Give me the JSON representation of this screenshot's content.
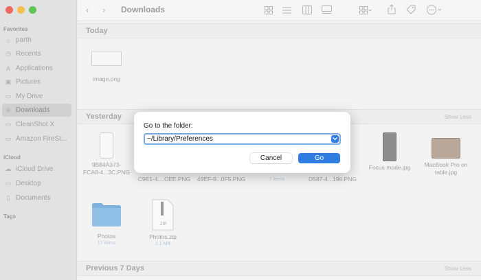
{
  "window": {
    "title": "Downloads"
  },
  "colors": {
    "close": "#ed6a5e",
    "minimize": "#f5bf4f",
    "zoom": "#61c554",
    "accent": "#2f7de1"
  },
  "sidebar": {
    "favorites_label": "Favorites",
    "favorites": [
      {
        "label": "parth",
        "icon": "home-icon"
      },
      {
        "label": "Recents",
        "icon": "clock-icon"
      },
      {
        "label": "Applications",
        "icon": "applications-icon"
      },
      {
        "label": "Pictures",
        "icon": "pictures-icon"
      },
      {
        "label": "My Drive",
        "icon": "drive-icon"
      },
      {
        "label": "Downloads",
        "icon": "download-icon",
        "selected": true
      },
      {
        "label": "CleanShot X",
        "icon": "folder-icon"
      },
      {
        "label": "Amazon FireSt...",
        "icon": "folder-icon"
      }
    ],
    "icloud_label": "iCloud",
    "icloud": [
      {
        "label": "iCloud Drive",
        "icon": "cloud-icon"
      },
      {
        "label": "Desktop",
        "icon": "desktop-icon"
      },
      {
        "label": "Documents",
        "icon": "document-icon"
      }
    ],
    "tags_label": "Tags"
  },
  "sections": {
    "today": "Today",
    "yesterday": "Yesterday",
    "previous": "Previous 7 Days",
    "show_less": "Show Less"
  },
  "files": {
    "image_png": {
      "name": "image.png"
    },
    "f1": {
      "name": "9B84A373-",
      "name2": "FCA8-4...3C.PNG"
    },
    "f2": {
      "name2": "C9E1-4....CEE.PNG"
    },
    "f3": {
      "name2": "49EF-9...0F5.PNG"
    },
    "f4": {
      "sub": "7 items"
    },
    "f5": {
      "name2": "D587-4...196.PNG"
    },
    "focus": {
      "name": "Focus mode.jpg"
    },
    "macbook": {
      "name": "MacBook Pro on",
      "name2": "table.jpg"
    },
    "photos": {
      "name": "Photos",
      "sub": "17 items"
    },
    "photos_zip": {
      "name": "Photos.zip",
      "sub": "2.1 MB",
      "badge": "ZIP"
    }
  },
  "dialog": {
    "label": "Go to the folder:",
    "path_value": "~/Library/Preferences",
    "cancel_label": "Cancel",
    "go_label": "Go"
  }
}
